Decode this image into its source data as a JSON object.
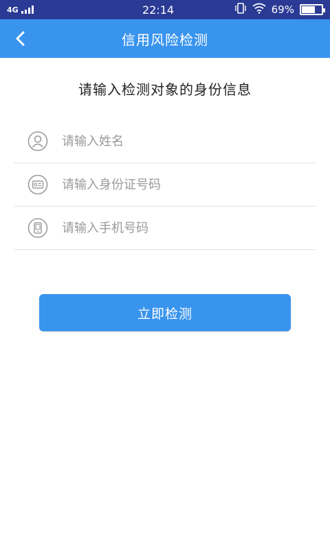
{
  "status_bar": {
    "network": "4G",
    "time": "22:14",
    "battery_percent": "69%",
    "battery_level": 0.69,
    "icons": [
      "signal-icon",
      "vibrate-icon",
      "wifi-icon",
      "battery-icon"
    ]
  },
  "header": {
    "title": "信用风险检测",
    "back_icon": "chevron-left-icon",
    "color": "#3994ee"
  },
  "page": {
    "heading": "请输入检测对象的身份信息"
  },
  "form": {
    "name": {
      "placeholder": "请输入姓名",
      "value": "",
      "icon": "person-icon"
    },
    "id_card": {
      "placeholder": "请输入身份证号码",
      "value": "",
      "icon": "id-card-icon"
    },
    "phone": {
      "placeholder": "请输入手机号码",
      "value": "",
      "icon": "phone-icon"
    }
  },
  "actions": {
    "submit_label": "立即检测"
  }
}
